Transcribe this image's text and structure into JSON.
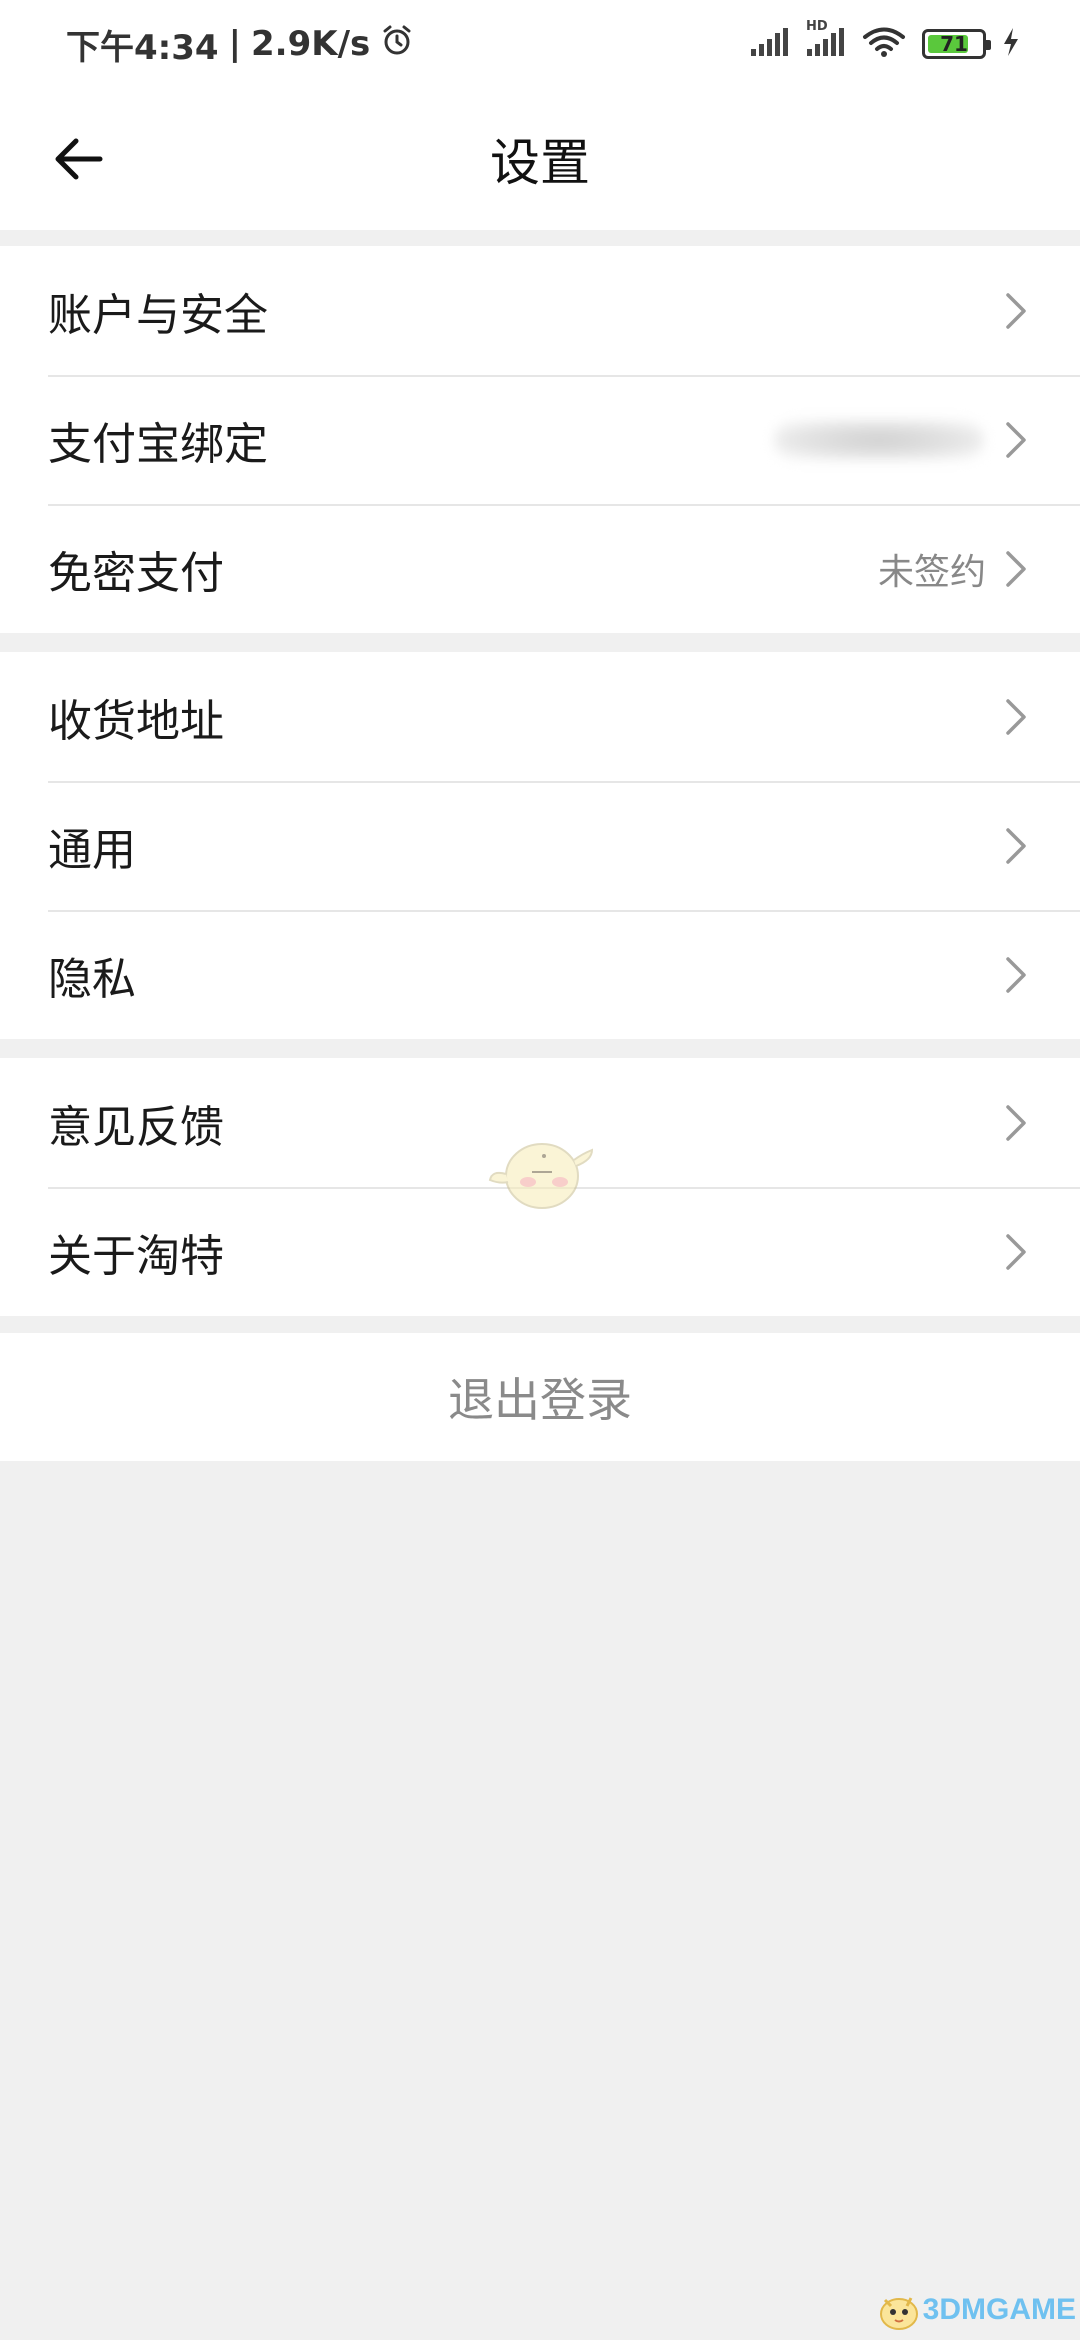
{
  "status_bar": {
    "time": "下午4:34",
    "separator": "|",
    "net_speed": "2.9K/s",
    "icons": [
      "alarm-icon",
      "signal-icon",
      "hd-signal-icon",
      "wifi-icon",
      "battery-icon",
      "charging-icon"
    ],
    "hd_label": "HD",
    "battery_level": "71",
    "battery_color": "#5ac83c"
  },
  "header": {
    "title": "设置",
    "back_icon": "arrow-left-icon"
  },
  "groups": [
    {
      "items": [
        {
          "label": "账户与安全",
          "value": ""
        },
        {
          "label": "支付宝绑定",
          "value": ""
        },
        {
          "label": "免密支付",
          "value": "未签约"
        }
      ]
    },
    {
      "items": [
        {
          "label": "收货地址",
          "value": ""
        },
        {
          "label": "通用",
          "value": ""
        },
        {
          "label": "隐私",
          "value": ""
        }
      ]
    },
    {
      "items": [
        {
          "label": "意见反馈",
          "value": ""
        },
        {
          "label": "关于淘特",
          "value": ""
        }
      ]
    }
  ],
  "logout_label": "退出登录",
  "watermark": {
    "text": "3DMGAME"
  },
  "colors": {
    "background": "#f0f0f0",
    "card": "#ffffff",
    "muted_text": "#888888",
    "logout_text": "#8a8a8a",
    "watermark": "#6fc1f0"
  }
}
